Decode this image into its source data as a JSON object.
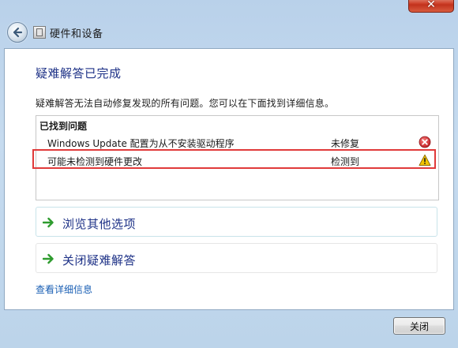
{
  "window": {
    "close_glyph": "✕",
    "title": "硬件和设备"
  },
  "main": {
    "heading": "疑难解答已完成",
    "description": "疑难解答无法自动修复发现的所有问题。您可以在下面找到详细信息。",
    "problems_header": "已找到问题",
    "problems": [
      {
        "name": "Windows Update 配置为从不安装驱动程序",
        "status": "未修复",
        "icon": "error-icon"
      },
      {
        "name": "可能未检测到硬件更改",
        "status": "检测到",
        "icon": "warning-icon"
      }
    ],
    "options": [
      {
        "label": "浏览其他选项",
        "icon": "green-arrow-icon"
      },
      {
        "label": "关闭疑难解答",
        "icon": "green-arrow-icon"
      }
    ],
    "details_link": "查看详细信息"
  },
  "footer": {
    "close_button": "关闭"
  },
  "colors": {
    "heading": "#1e3287",
    "link": "#1a5fb4",
    "highlight": "#e03a3a",
    "error": "#d6282b",
    "warning": "#f2c400"
  }
}
